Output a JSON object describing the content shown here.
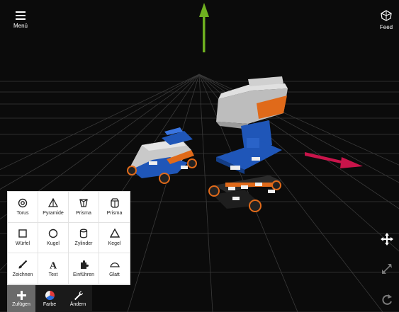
{
  "topbar": {
    "menu_label": "Menü",
    "feed_label": "Feed"
  },
  "shapes": [
    {
      "label": "Torus",
      "icon": "torus-icon"
    },
    {
      "label": "Pyramide",
      "icon": "pyramid-icon"
    },
    {
      "label": "Prisma",
      "icon": "prism-icon"
    },
    {
      "label": "Prisma",
      "icon": "prism-hex-icon"
    },
    {
      "label": "Würfel",
      "icon": "cube-icon"
    },
    {
      "label": "Kugel",
      "icon": "sphere-icon"
    },
    {
      "label": "Zylinder",
      "icon": "cylinder-icon"
    },
    {
      "label": "Kegel",
      "icon": "cone-icon"
    },
    {
      "label": "Zeichnen",
      "icon": "brush-icon"
    },
    {
      "label": "Text",
      "icon": "text-icon"
    },
    {
      "label": "Einführen",
      "icon": "import-icon"
    },
    {
      "label": "Glatt",
      "icon": "smooth-icon"
    }
  ],
  "bottom_bar": {
    "add_label": "Zufügen",
    "color_label": "Farbe",
    "modify_label": "Ändern"
  },
  "colors": {
    "accent_active": "#6a6a6a",
    "axis_y": "#6fb020",
    "axis_x": "#c8144a",
    "model_blue": "#1f56b8",
    "model_gray": "#bdbdbd",
    "model_orange": "#e06a1a"
  }
}
